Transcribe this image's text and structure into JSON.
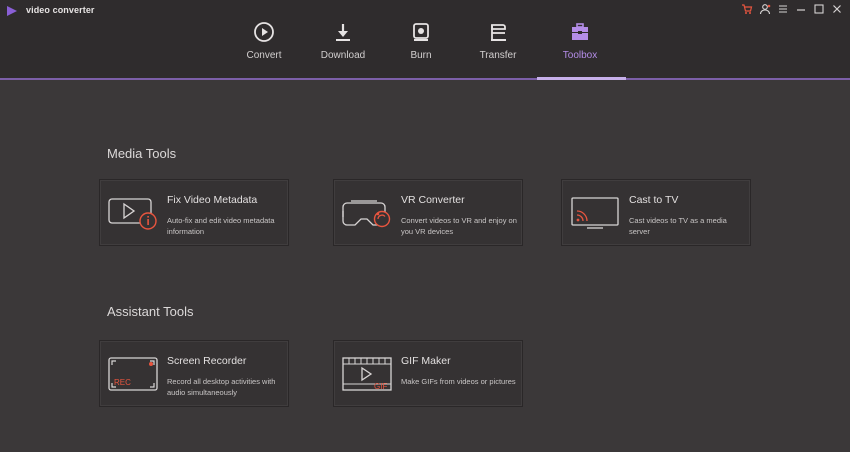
{
  "app": {
    "title": "video converter"
  },
  "window_controls": [
    "cart-icon",
    "user-icon",
    "menu-icon",
    "minimize-icon",
    "maximize-icon",
    "close-icon"
  ],
  "tabs": [
    {
      "label": "Convert",
      "icon": "convert-icon"
    },
    {
      "label": "Download",
      "icon": "download-icon"
    },
    {
      "label": "Burn",
      "icon": "burn-icon"
    },
    {
      "label": "Transfer",
      "icon": "transfer-icon"
    },
    {
      "label": "Toolbox",
      "icon": "toolbox-icon",
      "active": true
    }
  ],
  "sections": {
    "media": {
      "title": "Media Tools",
      "cards": [
        {
          "title": "Fix Video Metadata",
          "desc": "Auto-fix and edit video metadata information",
          "icon": "fix-metadata-icon"
        },
        {
          "title": "VR Converter",
          "desc": "Convert videos to VR and enjoy on you VR devices",
          "icon": "vr-headset-icon"
        },
        {
          "title": "Cast to TV",
          "desc": "Cast videos to TV as a media server",
          "icon": "cast-tv-icon"
        }
      ]
    },
    "assistant": {
      "title": "Assistant Tools",
      "cards": [
        {
          "title": "Screen Recorder",
          "desc": "Record all desktop activities with audio simultaneously",
          "icon": "screen-recorder-icon",
          "badge": "REC"
        },
        {
          "title": "GIF Maker",
          "desc": "Make GIFs from videos or pictures",
          "icon": "gif-maker-icon",
          "badge": "GIF"
        }
      ]
    }
  },
  "colors": {
    "accent": "#b48de8",
    "background": "#3b3839",
    "topbar": "#2f2c2d",
    "alert": "#e8553f"
  }
}
